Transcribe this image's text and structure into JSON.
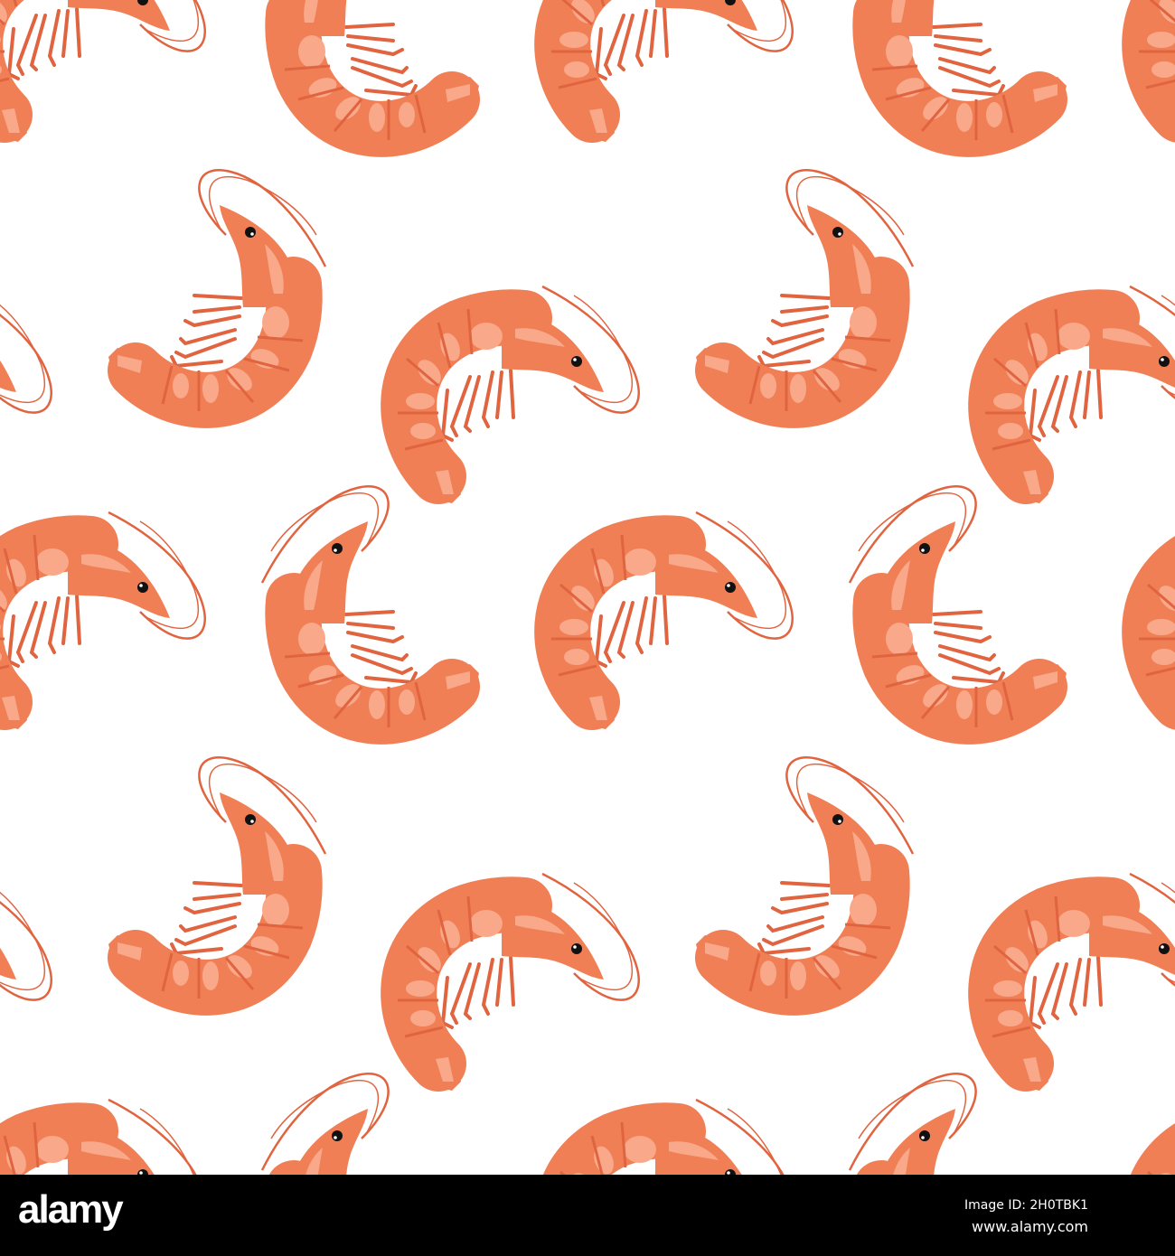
{
  "image": {
    "subject": "Seamless shrimp pattern",
    "colors": {
      "background": "#ffffff",
      "body": "#f07f55",
      "highlight": "#f9a88a",
      "shadow": "#e0643f",
      "eye": "#111111"
    }
  },
  "footer": {
    "logo": "alamy",
    "image_id": "Image ID: 2H0TBK1",
    "url": "www.alamy.com"
  }
}
